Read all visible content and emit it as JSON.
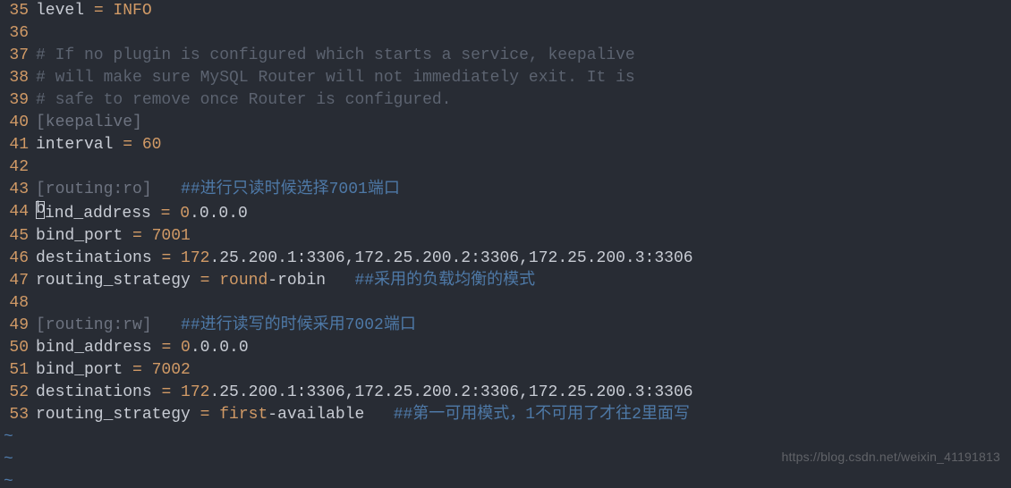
{
  "lines": [
    {
      "num": "35",
      "segments": [
        {
          "cls": "plain",
          "text": "level "
        },
        {
          "cls": "const",
          "text": "= INFO"
        }
      ]
    },
    {
      "num": "36",
      "segments": []
    },
    {
      "num": "37",
      "segments": [
        {
          "cls": "comment",
          "text": "# If no plugin is configured which starts a service, keepalive"
        }
      ]
    },
    {
      "num": "38",
      "segments": [
        {
          "cls": "comment",
          "text": "# will make sure MySQL Router will not immediately exit. It is"
        }
      ]
    },
    {
      "num": "39",
      "segments": [
        {
          "cls": "comment",
          "text": "# safe to remove once Router is configured."
        }
      ]
    },
    {
      "num": "40",
      "segments": [
        {
          "cls": "header",
          "text": "[keepalive]"
        }
      ]
    },
    {
      "num": "41",
      "segments": [
        {
          "cls": "plain",
          "text": "interval "
        },
        {
          "cls": "const",
          "text": "= 60"
        }
      ]
    },
    {
      "num": "42",
      "segments": []
    },
    {
      "num": "43",
      "segments": [
        {
          "cls": "header",
          "text": "[routing:ro]"
        },
        {
          "cls": "plain",
          "text": "   "
        },
        {
          "cls": "comment-zh",
          "text": "##进行只读时候选择7001端口"
        }
      ]
    },
    {
      "num": "44",
      "cursor": true,
      "segments": [
        {
          "cls": "plain",
          "text": "ind_address "
        },
        {
          "cls": "const",
          "text": "= 0"
        },
        {
          "cls": "plain",
          "text": ".0.0.0"
        }
      ]
    },
    {
      "num": "45",
      "segments": [
        {
          "cls": "plain",
          "text": "bind_port "
        },
        {
          "cls": "const",
          "text": "= 7001"
        }
      ]
    },
    {
      "num": "46",
      "segments": [
        {
          "cls": "plain",
          "text": "destinations "
        },
        {
          "cls": "const",
          "text": "= 172"
        },
        {
          "cls": "plain",
          "text": ".25.200.1:3306,172.25.200.2:3306,172.25.200.3:3306"
        }
      ]
    },
    {
      "num": "47",
      "segments": [
        {
          "cls": "plain",
          "text": "routing_strategy "
        },
        {
          "cls": "const",
          "text": "= round"
        },
        {
          "cls": "plain",
          "text": "-robin   "
        },
        {
          "cls": "comment-zh",
          "text": "##采用的负载均衡的模式"
        }
      ]
    },
    {
      "num": "48",
      "segments": []
    },
    {
      "num": "49",
      "segments": [
        {
          "cls": "header",
          "text": "[routing:rw]"
        },
        {
          "cls": "plain",
          "text": "   "
        },
        {
          "cls": "comment-zh",
          "text": "##进行读写的时候采用7002端口"
        }
      ]
    },
    {
      "num": "50",
      "segments": [
        {
          "cls": "plain",
          "text": "bind_address "
        },
        {
          "cls": "const",
          "text": "= 0"
        },
        {
          "cls": "plain",
          "text": ".0.0.0"
        }
      ]
    },
    {
      "num": "51",
      "segments": [
        {
          "cls": "plain",
          "text": "bind_port "
        },
        {
          "cls": "const",
          "text": "= 7002"
        }
      ]
    },
    {
      "num": "52",
      "segments": [
        {
          "cls": "plain",
          "text": "destinations "
        },
        {
          "cls": "const",
          "text": "= 172"
        },
        {
          "cls": "plain",
          "text": ".25.200.1:3306,172.25.200.2:3306,172.25.200.3:3306"
        }
      ]
    },
    {
      "num": "53",
      "segments": [
        {
          "cls": "plain",
          "text": "routing_strategy "
        },
        {
          "cls": "const",
          "text": "= first"
        },
        {
          "cls": "plain",
          "text": "-available   "
        },
        {
          "cls": "comment-zh",
          "text": "##第一可用模式，1不可用了才往2里面写"
        }
      ]
    }
  ],
  "tildes": [
    "~",
    "~",
    "~"
  ],
  "watermark": "https://blog.csdn.net/weixin_41191813"
}
